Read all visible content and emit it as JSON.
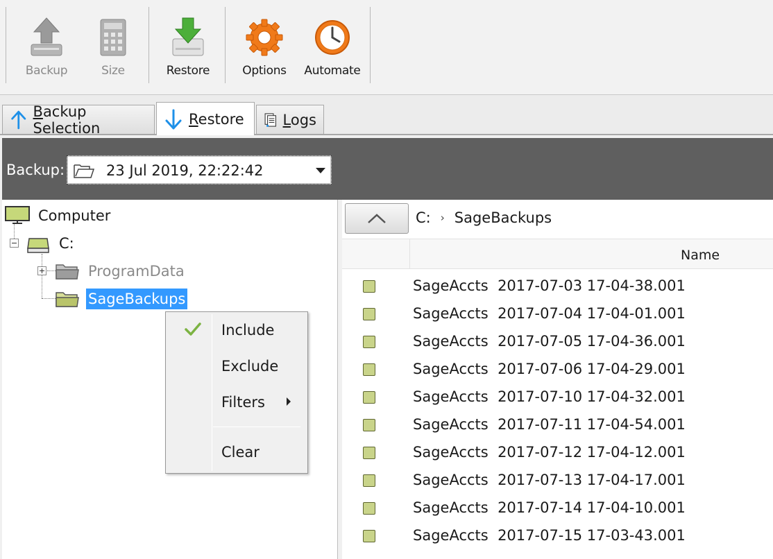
{
  "toolbar": {
    "backup_label": "Backup",
    "size_label": "Size",
    "restore_label": "Restore",
    "options_label": "Options",
    "automate_label": "Automate"
  },
  "tabs": [
    {
      "label_u": "B",
      "label_rest": "ackup Selection",
      "icon": "arrow-up-icon"
    },
    {
      "label_u": "R",
      "label_rest": "estore",
      "icon": "arrow-down-icon",
      "active": true
    },
    {
      "label_u": "L",
      "label_rest": "ogs",
      "icon": "logs-icon"
    }
  ],
  "backup_bar": {
    "label": "Backup:",
    "selected": "23 Jul 2019, 22:22:42"
  },
  "tree": {
    "computer": "Computer",
    "drive": "C:",
    "folder_programdata": "ProgramData",
    "folder_sagebackups": "SageBackups"
  },
  "context_menu": {
    "include": "Include",
    "exclude": "Exclude",
    "filters": "Filters",
    "clear": "Clear"
  },
  "files_panel": {
    "breadcrumb": [
      "C:",
      "SageBackups"
    ],
    "breadcrumb_sep": "›",
    "column_name": "Name",
    "rows": [
      "SageAccts  2017-07-03 17-04-38.001",
      "SageAccts  2017-07-04 17-04-01.001",
      "SageAccts  2017-07-05 17-04-36.001",
      "SageAccts  2017-07-06 17-04-29.001",
      "SageAccts  2017-07-10 17-04-32.001",
      "SageAccts  2017-07-11 17-04-54.001",
      "SageAccts  2017-07-12 17-04-12.001",
      "SageAccts  2017-07-13 17-04-17.001",
      "SageAccts  2017-07-14 17-04-10.001",
      "SageAccts  2017-07-15 17-03-43.001"
    ]
  },
  "colors": {
    "selection": "#3399ff",
    "dark_bar": "#5f5f5f",
    "file_icon": "#c9d48a",
    "check": "#7cb342",
    "options_orange": "#f07a1a"
  }
}
